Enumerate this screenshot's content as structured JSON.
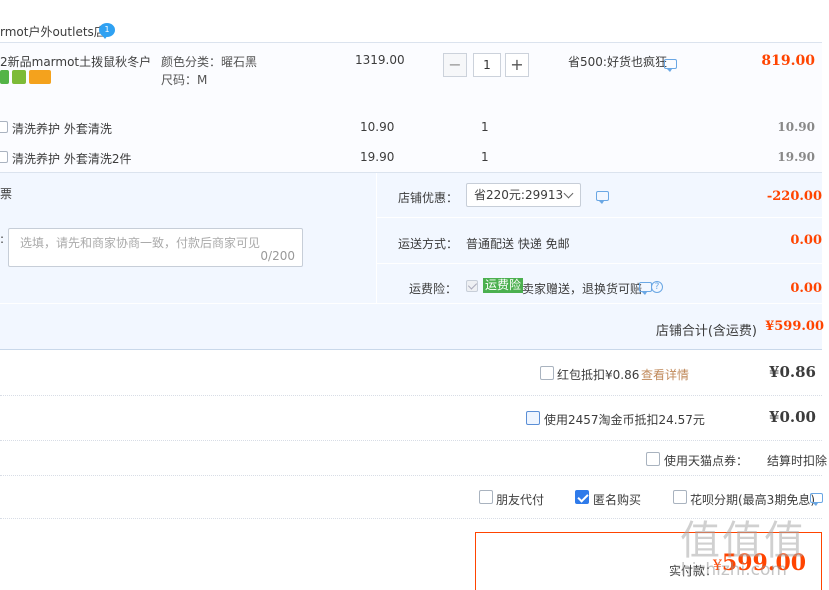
{
  "shop": {
    "name": "rmot户外outlets店",
    "ww_badge": "1"
  },
  "item": {
    "title": "2新品marmot土拨鼠秋冬户…",
    "sku_color": "颜色分类：曜石黑",
    "sku_size": "尺码：M",
    "price": "1319.00",
    "quantity": "1",
    "qty_minus": "−",
    "qty_plus": "+",
    "discount": "省500:好货也疯狂",
    "subtotal": "819.00"
  },
  "services": [
    {
      "name": "清洗养护 外套清洗",
      "price": "10.90",
      "qty": "1",
      "sum": "10.90"
    },
    {
      "name": "清洗养护 外套清洗2件",
      "price": "19.90",
      "qty": "1",
      "sum": "19.90"
    }
  ],
  "extras": {
    "invoice_label": "票",
    "message_colon": ":",
    "message_placeholder": "选填，请先和商家协商一致，付款后商家可见",
    "message_count": "0/200",
    "shop_discount_label": "店铺优惠：",
    "shop_discount_option": "省220元:29913",
    "shop_discount_value": "-220.00",
    "shipping_label": "运送方式：",
    "shipping_value": "普通配送 快递 免邮",
    "shipping_price": "0.00",
    "insurance_label": "运费险：",
    "insurance_tag": "运费险",
    "insurance_desc": "卖家赠送，退换货可赔",
    "insurance_price": "0.00"
  },
  "shop_total": {
    "label": "店铺合计(含运费)",
    "value": "¥599.00"
  },
  "options": {
    "red_packet": {
      "label": "红包抵扣¥0.86",
      "link": "查看详情",
      "value": "¥0.86"
    },
    "taojinbi": {
      "label": "使用2457淘金币抵扣24.57元",
      "value": "¥0.00"
    },
    "tmall_points": {
      "label": "使用天猫点券：",
      "value": "结算时扣除"
    },
    "friend_pay": {
      "label": "朋友代付"
    },
    "anonymous": {
      "label": "匿名购买"
    },
    "huabei": {
      "label": "花呗分期(最高3期免息)"
    }
  },
  "payment": {
    "label": "实付款：",
    "currency": "¥",
    "value": "599.00"
  },
  "watermark": {
    "main": "值值值",
    "sub": "zhizhizhi.com"
  },
  "colors": {
    "accent_red": "#ff4400",
    "link_blue": "#2f7bea",
    "panel_blue": "#f2f7ff",
    "insurance_green": "#4bb04f"
  }
}
